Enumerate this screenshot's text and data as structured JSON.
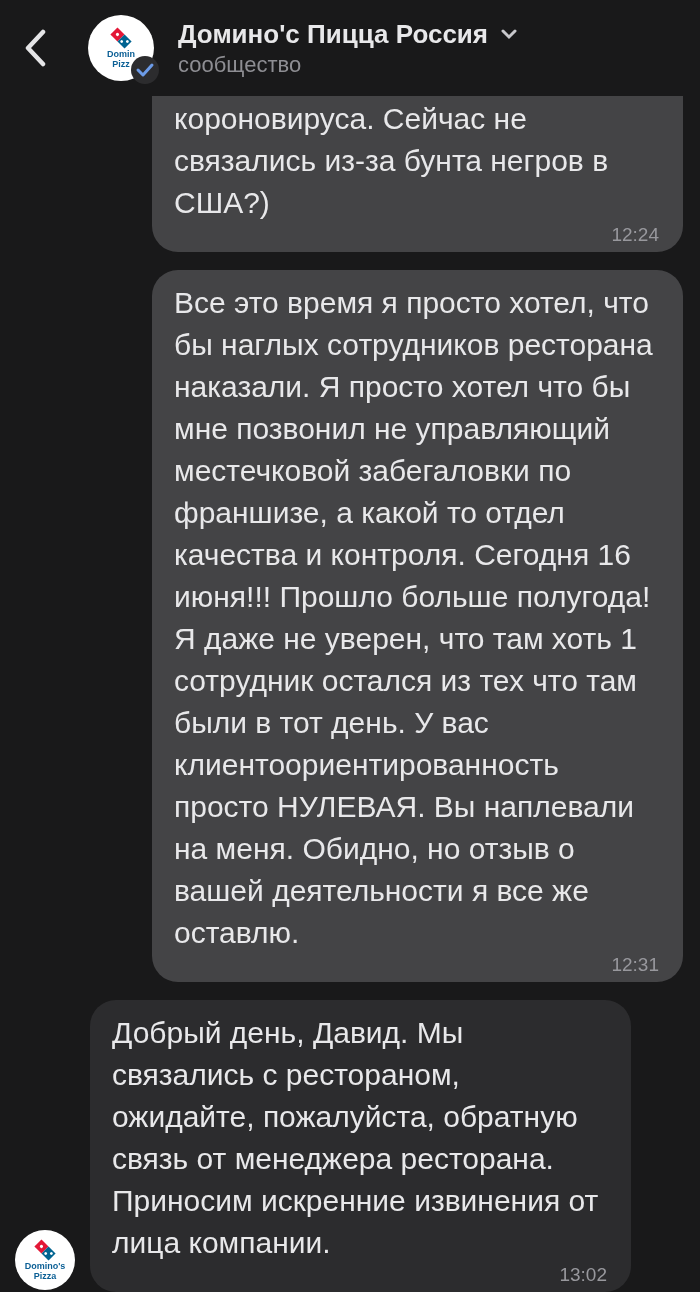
{
  "header": {
    "title": "Домино'с Пицца Россия",
    "subtitle": "сообщество",
    "verified": true,
    "avatar_logo": [
      "Domin",
      "Pizz"
    ]
  },
  "messages": [
    {
      "kind": "outgoing",
      "text": "короновируса. Сейчас не связались из-за бунта негров в США?)",
      "time": "12:24"
    },
    {
      "kind": "outgoing",
      "text": "Все это время я просто хотел, что бы наглых сотрудников ресторана наказали. Я просто хотел что бы мне позвонил не управляющий местечковой забегаловки по франшизе, а какой то отдел качества и контроля. Сегодня 16 июня!!! Прошло больше полугода! Я даже не уверен, что там хоть 1 сотрудник остался из тех что там были в тот день. У вас клиентоориентированность просто НУЛЕВАЯ. Вы наплевали на меня. Обидно, но отзыв о вашей деятельности я все же оставлю.",
      "time": "12:31"
    },
    {
      "kind": "incoming",
      "text": "Добрый день, Давид. Мы связались с рестораном, ожидайте, пожалуйста, обратную связь от менеджера ресторана. Приносим искренние извинения от лица компании.",
      "time": "13:02",
      "avatar_logo": [
        "Domino's",
        "Pizza"
      ]
    }
  ]
}
